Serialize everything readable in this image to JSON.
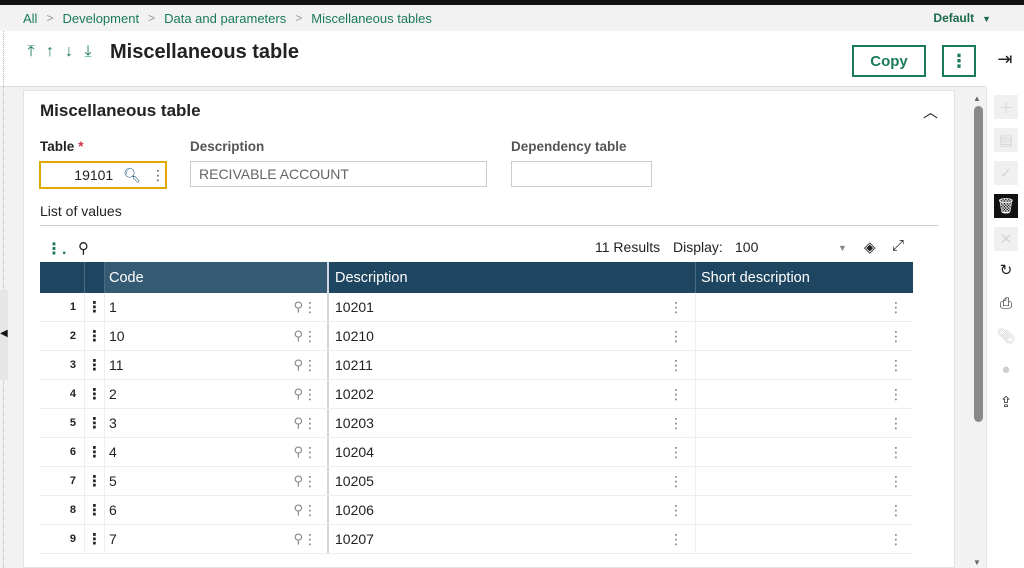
{
  "breadcrumb": [
    "All",
    "Development",
    "Data and parameters",
    "Miscellaneous tables"
  ],
  "profile_selector": "Default",
  "header": {
    "title": "Miscellaneous table",
    "copy_label": "Copy"
  },
  "section": {
    "title": "Miscellaneous table"
  },
  "fields": {
    "table_label": "Table",
    "table_required_mark": "*",
    "table_value": "19101",
    "description_label": "Description",
    "description_value": "RECIVABLE ACCOUNT",
    "dependency_label": "Dependency table",
    "dependency_value": ""
  },
  "list": {
    "label": "List of values",
    "results_text": "11 Results",
    "display_label": "Display:",
    "display_value": "100",
    "columns": [
      "Code",
      "Description",
      "Short description"
    ],
    "rows": [
      {
        "num": "1",
        "code": "1",
        "description": "10201",
        "short": ""
      },
      {
        "num": "2",
        "code": "10",
        "description": "10210",
        "short": ""
      },
      {
        "num": "3",
        "code": "11",
        "description": "10211",
        "short": ""
      },
      {
        "num": "4",
        "code": "2",
        "description": "10202",
        "short": ""
      },
      {
        "num": "5",
        "code": "3",
        "description": "10203",
        "short": ""
      },
      {
        "num": "6",
        "code": "4",
        "description": "10204",
        "short": ""
      },
      {
        "num": "7",
        "code": "5",
        "description": "10205",
        "short": ""
      },
      {
        "num": "8",
        "code": "6",
        "description": "10206",
        "short": ""
      },
      {
        "num": "9",
        "code": "7",
        "description": "10207",
        "short": ""
      }
    ]
  },
  "icons": {
    "nav": [
      "first-record-icon",
      "previous-record-icon",
      "next-record-icon",
      "last-record-icon"
    ],
    "rail": [
      "add-icon",
      "save-icon",
      "validate-icon",
      "delete-icon",
      "cancel-icon",
      "refresh-icon",
      "print-icon",
      "attachment-icon",
      "comment-icon",
      "export-icon"
    ]
  },
  "colors": {
    "accent": "#1a7a5a",
    "grid_header": "#1e4660",
    "focus_border": "#e0a800",
    "required": "#d0304a"
  }
}
